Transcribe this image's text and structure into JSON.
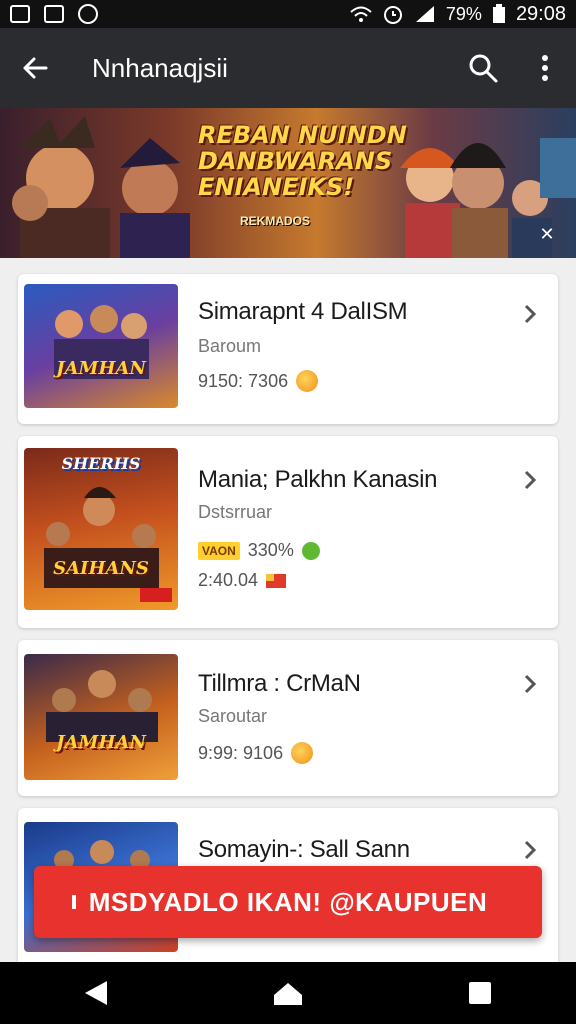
{
  "status_bar": {
    "battery": "79%",
    "time": "29:08",
    "left_icons": [
      "image-icon",
      "gallery-icon",
      "sync-icon"
    ],
    "right_icons": [
      "wifi-icon",
      "alarm-icon",
      "signal-icon",
      "battery-icon"
    ]
  },
  "app_bar": {
    "title": "Nnhanaqjsii",
    "back_icon": "arrow-left-icon",
    "actions": [
      "search-icon",
      "more-vert-icon"
    ]
  },
  "banner": {
    "headline_lines": [
      "REBAN NUINDN",
      "DANBWARANS",
      "ENIANEIKS!"
    ],
    "subtext": "REKMADOS",
    "corner_icon": "expand-icon"
  },
  "games": [
    {
      "title": "Simarapnt 4 DalISM",
      "subtitle": "Baroum",
      "meta": "9150: 7306",
      "badge": "coin",
      "thumb_label": "JAMHAN"
    },
    {
      "title": "Mania; Palkhn Kanasin",
      "subtitle": "Dstsrruar",
      "tag": "VAON",
      "meta": "330%",
      "meta2": "2:40.04",
      "badge": "green",
      "thumb_label": "SAIHANS",
      "thumb_top_label": "SHERHS"
    },
    {
      "title": "Tillmra : CrMaN",
      "subtitle": "Saroutar",
      "meta": "9:99: 9106",
      "badge": "coin",
      "thumb_label": "JAMHAN"
    },
    {
      "title": "Somayin-: Sall Sann",
      "thumb_label": ""
    }
  ],
  "cta": {
    "label": "MSDYADLO IKAN! @KAUPUEN"
  },
  "nav_bar": {
    "buttons": [
      "back-triangle-icon",
      "home-icon",
      "recents-icon"
    ]
  },
  "colors": {
    "accent": "#e8322d",
    "appbar": "#2b2c30",
    "background": "#efefef"
  }
}
